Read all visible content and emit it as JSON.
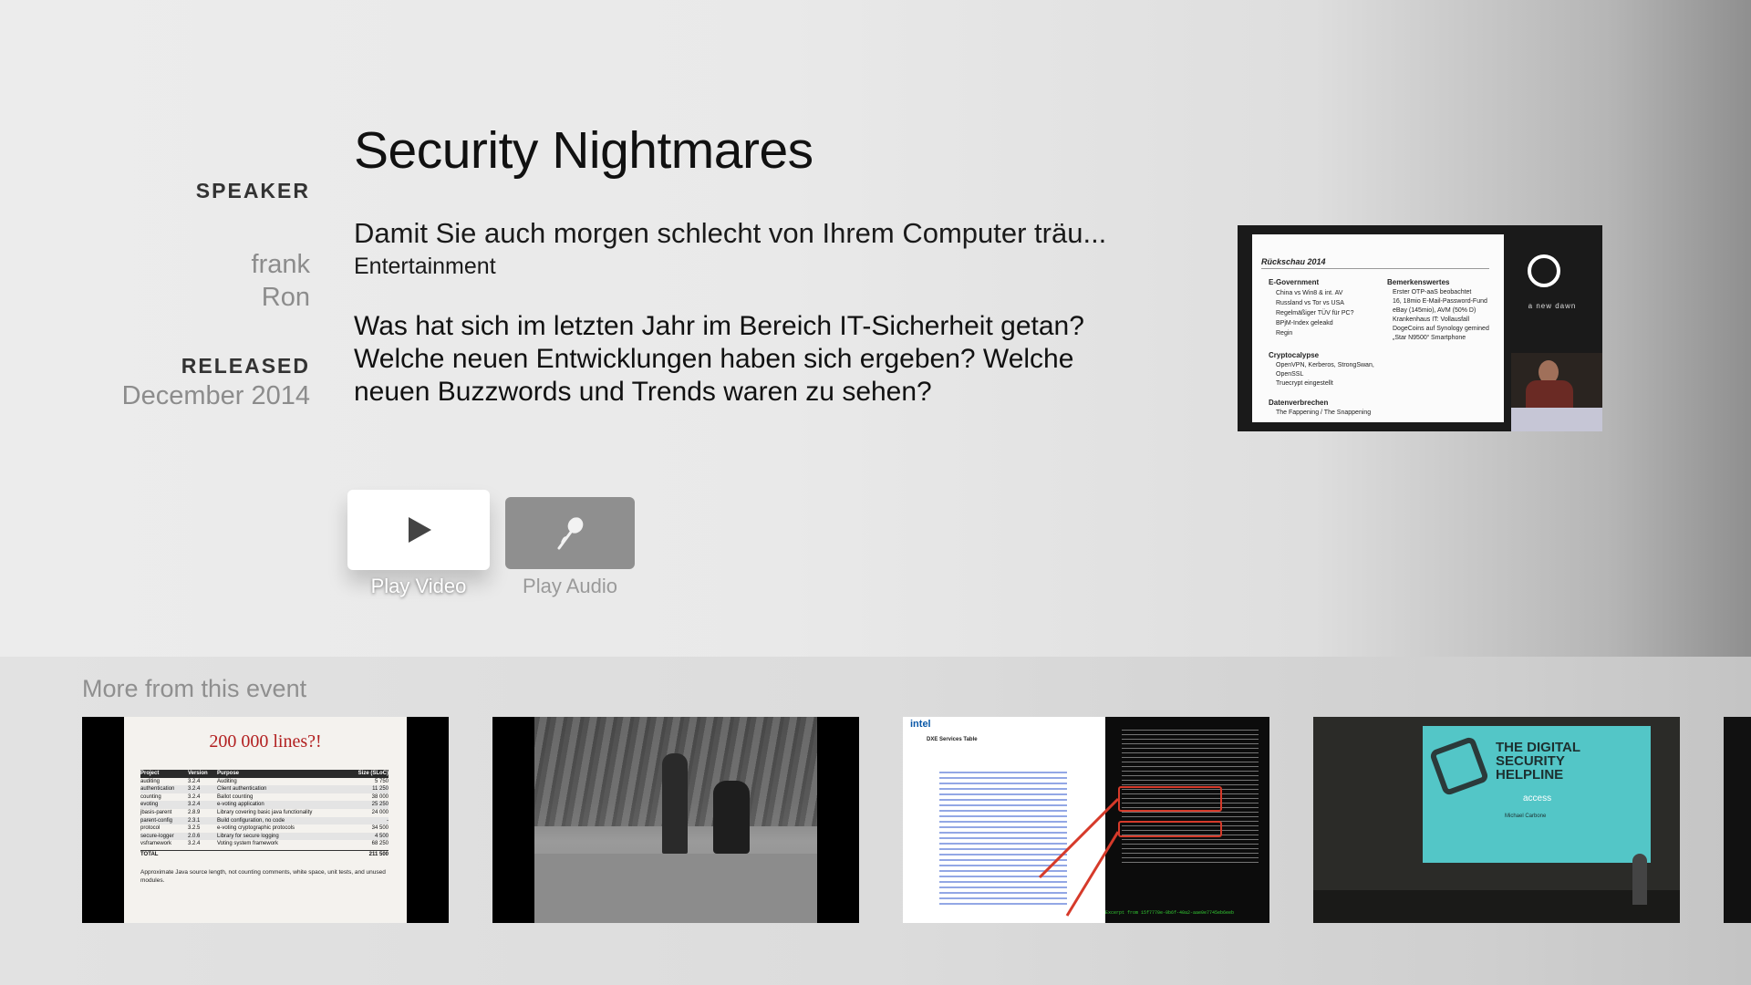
{
  "talk": {
    "title": "Security Nightmares",
    "subtitle": "Damit Sie auch morgen schlecht von Ihrem Computer träu...",
    "category": "Entertainment",
    "description": "Was hat sich im letzten Jahr im Bereich IT-Sicherheit getan? Welche neuen Entwicklungen haben sich ergeben? Welche neuen Buzzwords und Trends waren zu sehen?"
  },
  "meta": {
    "speaker_label": "SPEAKER",
    "speakers": [
      "frank",
      "Ron"
    ],
    "released_label": "RELEASED",
    "released_value": "December 2014"
  },
  "actions": {
    "play_video": "Play Video",
    "play_audio": "Play Audio"
  },
  "preview": {
    "slide_title": "Rückschau 2014",
    "col1_heading": "E-Government",
    "col1_items": [
      "China vs Win8 & int. AV",
      "Russland vs Tor vs USA",
      "Regelmäßiger TÜV für PC?",
      "BPjM-Index geleakd",
      "Regin"
    ],
    "col1_heading2": "Cryptocalypse",
    "col1_items2": [
      "OpenVPN, Kerberos, StrongSwan, OpenSSL",
      "Truecrypt eingestellt"
    ],
    "col1_heading3": "Datenverbrechen",
    "col1_items3": [
      "The Fappening / The Snappening"
    ],
    "col2_heading": "Bemerkenswertes",
    "col2_items": [
      "Erster OTP-aaS beobachtet",
      "16, 18mio E-Mail-Password-Fund eBay (145mio), AVM (50% D)",
      "Krankenhaus IT: Vollausfall",
      "DogeCoins auf Synology gemined",
      "„Star N9500“ Smartphone"
    ],
    "logo_text": "a new dawn"
  },
  "more": {
    "section_title": "More from this event",
    "thumb1": {
      "heading": "200 000 lines?!",
      "columns": [
        "Project",
        "Version",
        "Purpose",
        "Size (SLoC)"
      ],
      "rows": [
        [
          "auditing",
          "3.2.4",
          "Auditing",
          "5 750"
        ],
        [
          "authentication",
          "3.2.4",
          "Client authentication",
          "11 250"
        ],
        [
          "counting",
          "3.2.4",
          "Ballot counting",
          "38 000"
        ],
        [
          "evoting",
          "3.2.4",
          "e-voting application",
          "25 250"
        ],
        [
          "jbasis-parent",
          "2.8.9",
          "Library covering basic java functionality",
          "24 000"
        ],
        [
          "parent-config",
          "2.3.1",
          "Build configuration, no code",
          "-"
        ],
        [
          "protocol",
          "3.2.5",
          "e-voting cryptographic protocols",
          "34 500"
        ],
        [
          "secure-logger",
          "2.0.6",
          "Library for secure logging",
          "4 500"
        ],
        [
          "vsframework",
          "3.2.4",
          "Voting system framework",
          "68 250"
        ]
      ],
      "total_label": "TOTAL",
      "total_value": "211 500",
      "note": "Approximate Java source length, not counting comments, white space, unit tests, and unused modules."
    },
    "thumb3": {
      "brand": "intel",
      "heading": "DXE Services Table",
      "footer": "Excerpt from 15f7770e-0b6f-40a2-aae0e7745eb6eeb"
    },
    "thumb4": {
      "screen_title": "THE DIGITAL SECURITY HELPLINE",
      "screen_brand": "access",
      "presenter": "Michael Carbone"
    }
  }
}
